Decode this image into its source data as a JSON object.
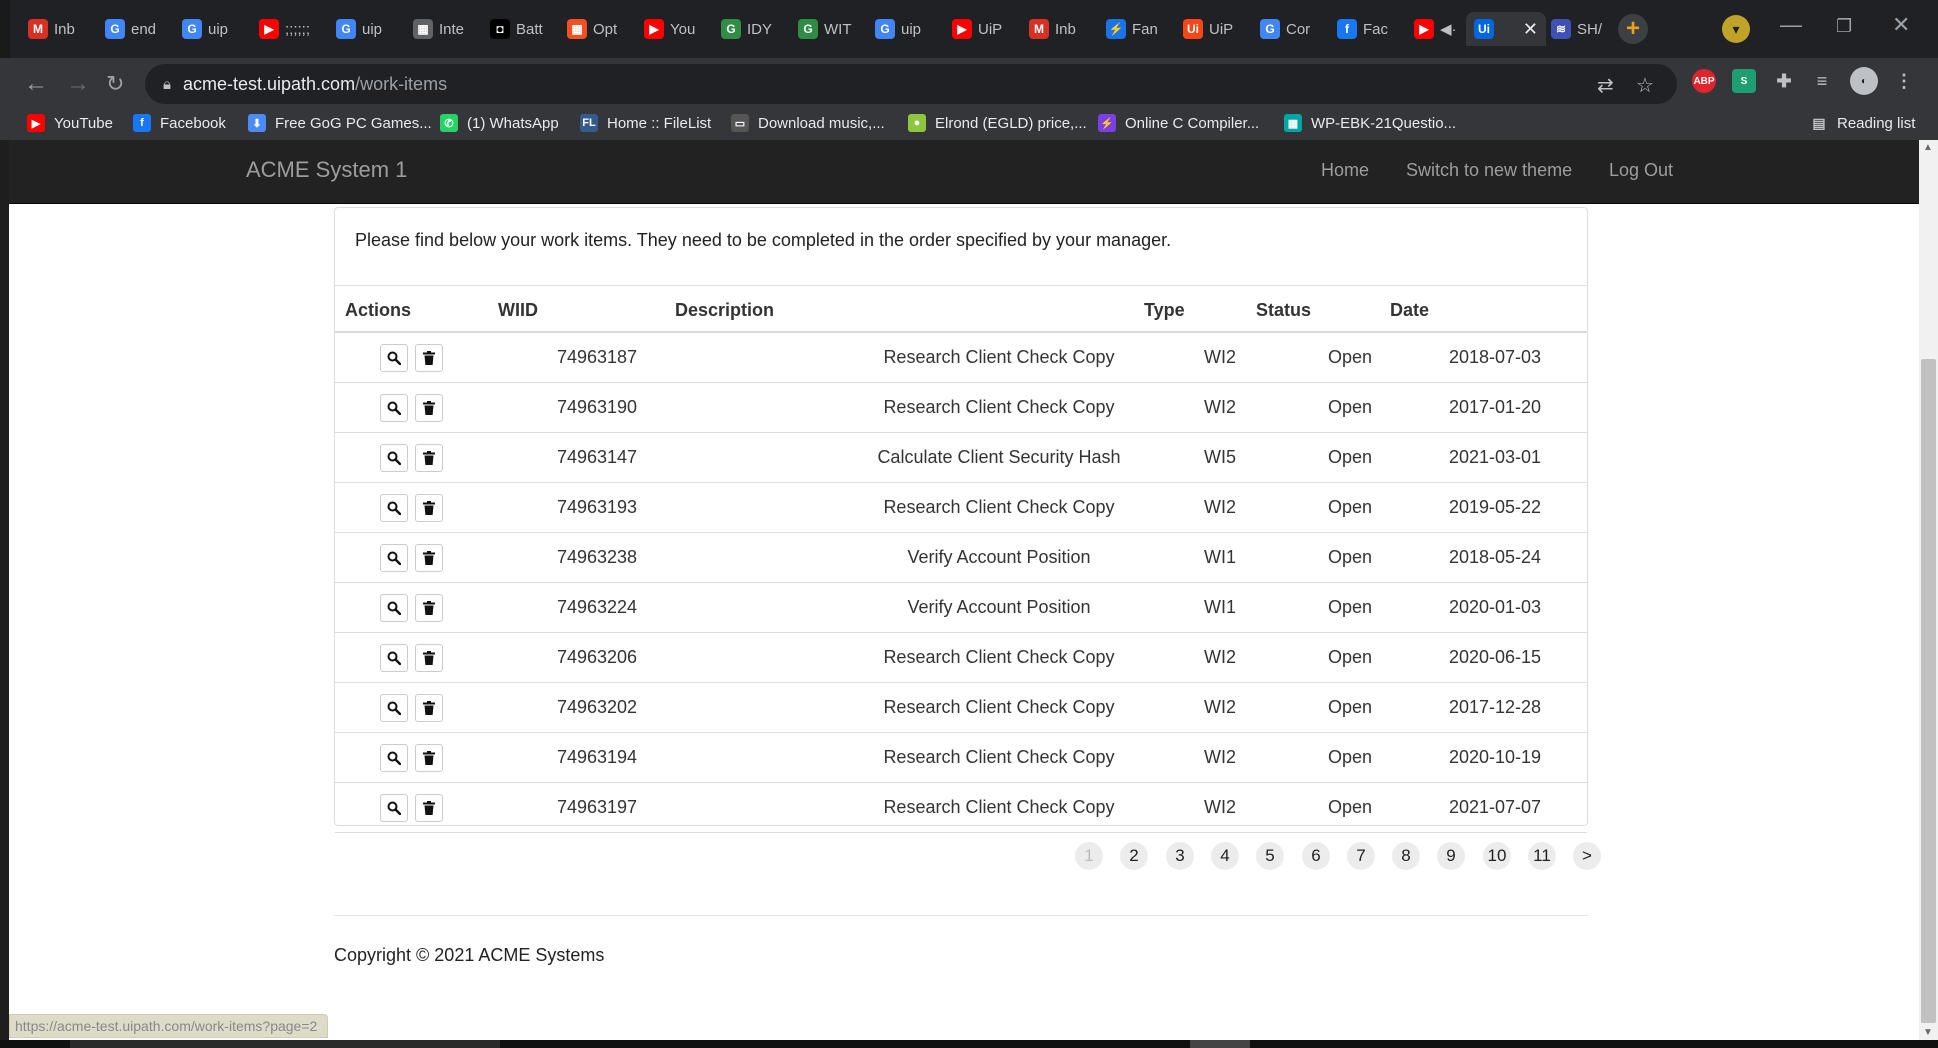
{
  "browser": {
    "tabs": [
      {
        "label": "Inb",
        "icon": "gmail-icon",
        "color": "#d93025",
        "glyph": "M"
      },
      {
        "label": "end",
        "icon": "google-icon",
        "color": "#4285f4",
        "glyph": "G"
      },
      {
        "label": "uip",
        "icon": "google-icon",
        "color": "#4285f4",
        "glyph": "G"
      },
      {
        "label": ";;;;;;",
        "icon": "youtube-icon",
        "color": "#ff0000",
        "glyph": "▶"
      },
      {
        "label": "uip",
        "icon": "google-icon",
        "color": "#4285f4",
        "glyph": "G"
      },
      {
        "label": "Inte",
        "icon": "calculator-icon",
        "color": "#5f6368",
        "glyph": "▦"
      },
      {
        "label": "Batt",
        "icon": "battery-icon",
        "color": "#000000",
        "glyph": "◘"
      },
      {
        "label": "Opt",
        "icon": "microsoft-icon",
        "color": "#f25022",
        "glyph": "▦"
      },
      {
        "label": "You",
        "icon": "youtube-icon",
        "color": "#ff0000",
        "glyph": "▶"
      },
      {
        "label": "IDY",
        "icon": "gfg-icon",
        "color": "#2f8d46",
        "glyph": "G"
      },
      {
        "label": "WIT",
        "icon": "gfg-icon",
        "color": "#2f8d46",
        "glyph": "G"
      },
      {
        "label": "uip",
        "icon": "google-icon",
        "color": "#4285f4",
        "glyph": "G"
      },
      {
        "label": "UiP",
        "icon": "youtube-icon",
        "color": "#ff0000",
        "glyph": "▶"
      },
      {
        "label": "Inb",
        "icon": "gmail-icon",
        "color": "#d93025",
        "glyph": "M"
      },
      {
        "label": "Fan",
        "icon": "bolt-icon",
        "color": "#1a73e8",
        "glyph": "⚡"
      },
      {
        "label": "UiP",
        "icon": "uipath-icon",
        "color": "#fa4616",
        "glyph": "Ui"
      },
      {
        "label": "Cor",
        "icon": "google-icon",
        "color": "#4285f4",
        "glyph": "G"
      },
      {
        "label": "Fac",
        "icon": "facebook-icon",
        "color": "#1877f2",
        "glyph": "f"
      },
      {
        "label": "◀·",
        "icon": "youtube-icon",
        "color": "#ff0000",
        "glyph": "▶"
      },
      {
        "label": "",
        "icon": "uipath-icon",
        "color": "#0067df",
        "glyph": "Ui"
      },
      {
        "label": "SH/",
        "icon": "waveform-icon",
        "color": "#3f51b5",
        "glyph": "≋"
      }
    ],
    "url_host": "acme-test.uipath.com",
    "url_path": "/work-items",
    "bookmarks": [
      {
        "label": "YouTube",
        "icon": "youtube-icon",
        "color": "#ff0000",
        "glyph": "▶"
      },
      {
        "label": "Facebook",
        "icon": "facebook-icon",
        "color": "#1877f2",
        "glyph": "f"
      },
      {
        "label": "Free GoG PC Games...",
        "icon": "download-arrow-icon",
        "color": "#4c8bf5",
        "glyph": "⬇"
      },
      {
        "label": "(1) WhatsApp",
        "icon": "whatsapp-icon",
        "color": "#25d366",
        "glyph": "✆"
      },
      {
        "label": "Home :: FileList",
        "icon": "filelist-icon",
        "color": "#355a8e",
        "glyph": "FL"
      },
      {
        "label": "Download music,...",
        "icon": "monitor-icon",
        "color": "#555555",
        "glyph": "▭"
      },
      {
        "label": "Elrond (EGLD) price,...",
        "icon": "coin-icon",
        "color": "#8dc63f",
        "glyph": "●"
      },
      {
        "label": "Online C Compiler...",
        "icon": "lightning-icon",
        "color": "#7b3fe4",
        "glyph": "⚡"
      },
      {
        "label": "WP-EBK-21Questio...",
        "icon": "grid-icon",
        "color": "#00a6a6",
        "glyph": "▦"
      }
    ],
    "reading_list": "Reading list",
    "status_url": "https://acme-test.uipath.com/work-items?page=2"
  },
  "app": {
    "brand": "ACME System 1",
    "nav": [
      "Home",
      "Switch to new theme",
      "Log Out"
    ],
    "intro": "Please find below your work items. They need to be completed in the order specified by your manager.",
    "columns": [
      "Actions",
      "WIID",
      "Description",
      "Type",
      "Status",
      "Date"
    ],
    "rows": [
      {
        "wiid": "74963187",
        "description": "Research Client Check Copy",
        "type": "WI2",
        "status": "Open",
        "date": "2018-07-03"
      },
      {
        "wiid": "74963190",
        "description": "Research Client Check Copy",
        "type": "WI2",
        "status": "Open",
        "date": "2017-01-20"
      },
      {
        "wiid": "74963147",
        "description": "Calculate Client Security Hash",
        "type": "WI5",
        "status": "Open",
        "date": "2021-03-01"
      },
      {
        "wiid": "74963193",
        "description": "Research Client Check Copy",
        "type": "WI2",
        "status": "Open",
        "date": "2019-05-22"
      },
      {
        "wiid": "74963238",
        "description": "Verify Account Position",
        "type": "WI1",
        "status": "Open",
        "date": "2018-05-24"
      },
      {
        "wiid": "74963224",
        "description": "Verify Account Position",
        "type": "WI1",
        "status": "Open",
        "date": "2020-01-03"
      },
      {
        "wiid": "74963206",
        "description": "Research Client Check Copy",
        "type": "WI2",
        "status": "Open",
        "date": "2020-06-15"
      },
      {
        "wiid": "74963202",
        "description": "Research Client Check Copy",
        "type": "WI2",
        "status": "Open",
        "date": "2017-12-28"
      },
      {
        "wiid": "74963194",
        "description": "Research Client Check Copy",
        "type": "WI2",
        "status": "Open",
        "date": "2020-10-19"
      },
      {
        "wiid": "74963197",
        "description": "Research Client Check Copy",
        "type": "WI2",
        "status": "Open",
        "date": "2021-07-07"
      }
    ],
    "pagination": {
      "current": "1",
      "pages": [
        "1",
        "2",
        "3",
        "4",
        "5",
        "6",
        "7",
        "8",
        "9",
        "10",
        "11"
      ],
      "next": ">"
    },
    "copyright": "Copyright © 2021 ACME Systems"
  },
  "colors": {
    "navbar_bg": "#222222",
    "navbar_text": "#9d9d9d",
    "chrome_bg": "#35363a",
    "tabstrip_bg": "#202124"
  }
}
